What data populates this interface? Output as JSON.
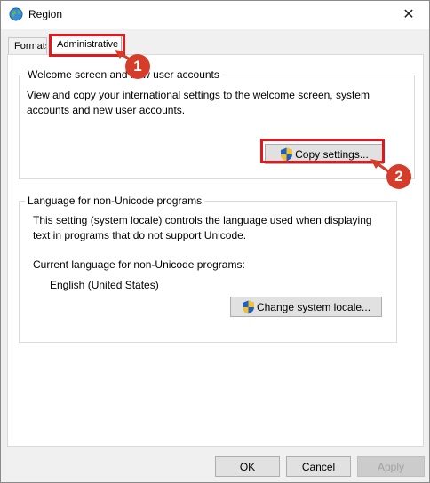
{
  "window": {
    "title": "Region",
    "close_glyph": "✕"
  },
  "tabs": [
    {
      "label": "Formats",
      "active": false
    },
    {
      "label": "Administrative",
      "active": true
    }
  ],
  "welcome_group": {
    "title": "Welcome screen and new user accounts",
    "description_line1": "View and copy your international settings to the welcome screen, system",
    "description_line2": "accounts and new user accounts.",
    "copy_button": "Copy settings..."
  },
  "language_group": {
    "title": "Language for non-Unicode programs",
    "description_line1": "This setting (system locale) controls the language used when displaying",
    "description_line2": "text in programs that do not support Unicode.",
    "current_label": "Current language for non-Unicode programs:",
    "current_value": "English (United States)",
    "change_button": "Change system locale..."
  },
  "footer": {
    "ok": "OK",
    "cancel": "Cancel",
    "apply": "Apply"
  },
  "annotations": [
    {
      "number": "1"
    },
    {
      "number": "2"
    }
  ],
  "colors": {
    "highlight_red": "#e0191e",
    "callout_red": "#d63c2a",
    "dialog_bg": "#f0f0f0"
  },
  "icons": {
    "title": "globe-icon",
    "uac": "uac-shield-icon"
  }
}
